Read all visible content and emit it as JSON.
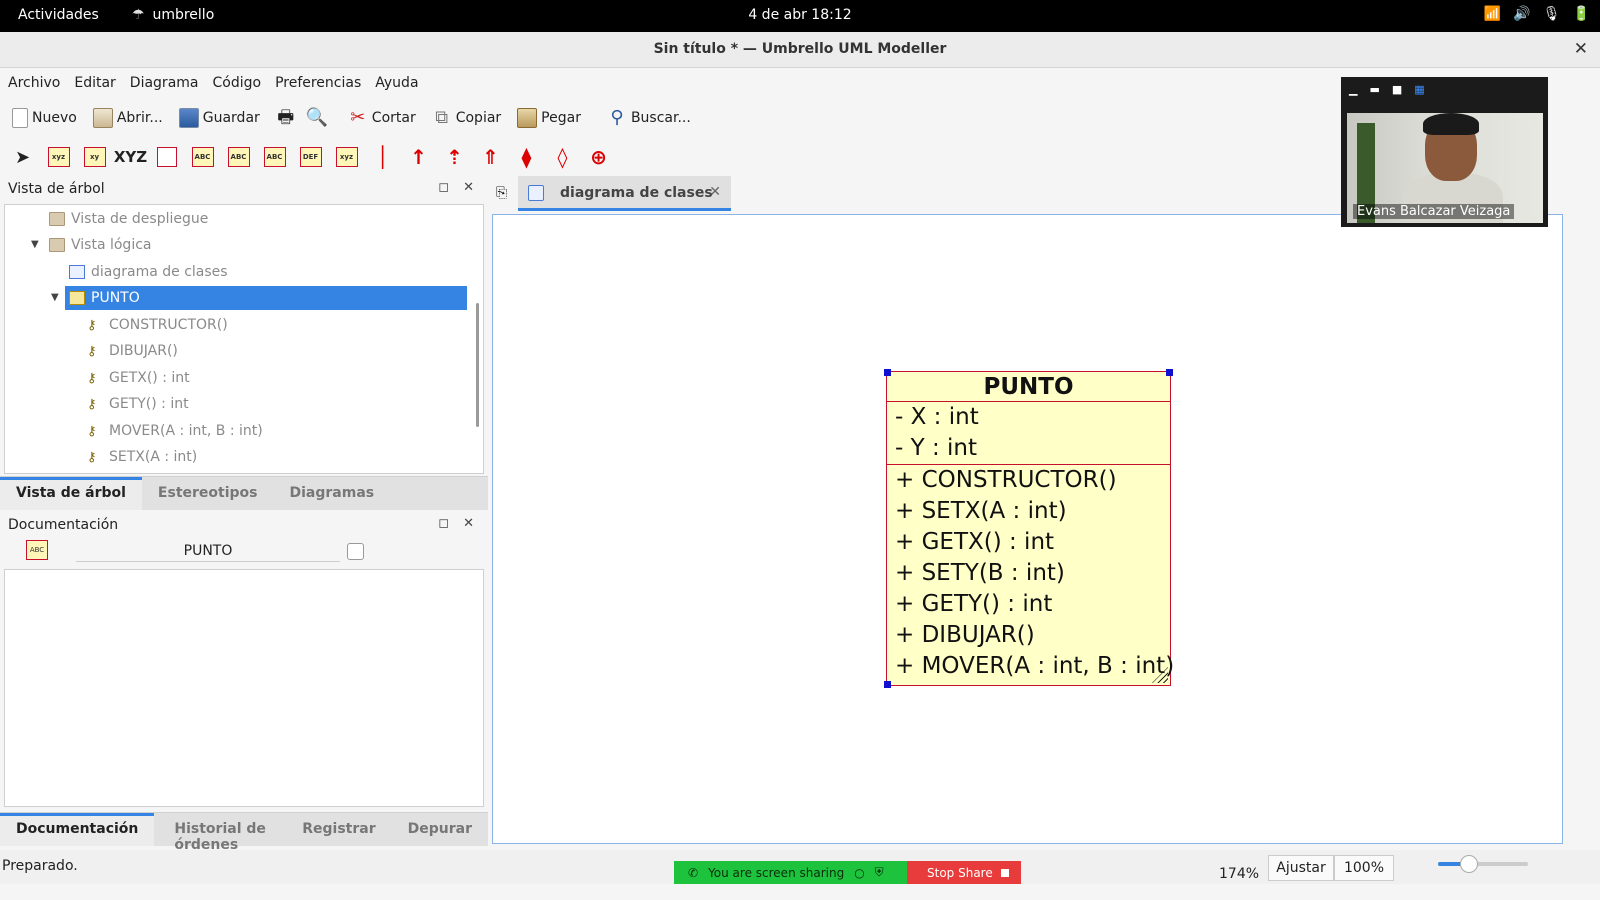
{
  "topbar": {
    "activities": "Actividades",
    "app_name": "umbrello",
    "clock": "4 de abr  18:12"
  },
  "window": {
    "title": "Sin título * — Umbrello UML Modeller"
  },
  "menu": [
    "Archivo",
    "Editar",
    "Diagrama",
    "Código",
    "Preferencias",
    "Ayuda"
  ],
  "toolbar": {
    "new": "Nuevo",
    "open": "Abrir...",
    "save": "Guardar",
    "cut": "Cortar",
    "copy": "Copiar",
    "paste": "Pegar",
    "find": "Buscar..."
  },
  "uml_tools": {
    "xyz": "XYZ"
  },
  "tree_dock": {
    "title": "Vista de árbol",
    "items": [
      "Vista de despliegue",
      "Vista lógica",
      "diagrama de clases",
      "PUNTO",
      "CONSTRUCTOR()",
      "DIBUJAR()",
      "GETX() : int",
      "GETY() : int",
      "MOVER(A : int, B : int)",
      "SETX(A : int)"
    ],
    "tabs": [
      "Vista de árbol",
      "Estereotipos",
      "Diagramas"
    ]
  },
  "doc_dock": {
    "title": "Documentación",
    "name_field": "PUNTO",
    "tabs": [
      "Documentación",
      "Historial de órdenes",
      "Registrar",
      "Depurar"
    ]
  },
  "diagram": {
    "tab_label": "diagrama de clases",
    "class": {
      "name": "PUNTO",
      "attributes": [
        "- X : int",
        "- Y : int"
      ],
      "operations": [
        "+ CONSTRUCTOR()",
        "+ SETX(A : int)",
        "+ GETX() : int",
        "+ SETY(B : int)",
        "+ GETY() : int",
        "+ DIBUJAR()",
        "+ MOVER(A : int, B : int)"
      ]
    }
  },
  "video": {
    "participant": "Evans Balcazar Veizaga"
  },
  "status": {
    "text": "Preparado.",
    "sharing": "You are screen sharing",
    "stop_share": "Stop Share",
    "zoom": "174%",
    "fit": "Ajustar",
    "hundred": "100%"
  },
  "colors": {
    "accent": "#3584e4",
    "class_fill": "#ffffc8",
    "class_border": "#c8102e",
    "share_green": "#1ec33d",
    "stop_red": "#e83b3b"
  }
}
